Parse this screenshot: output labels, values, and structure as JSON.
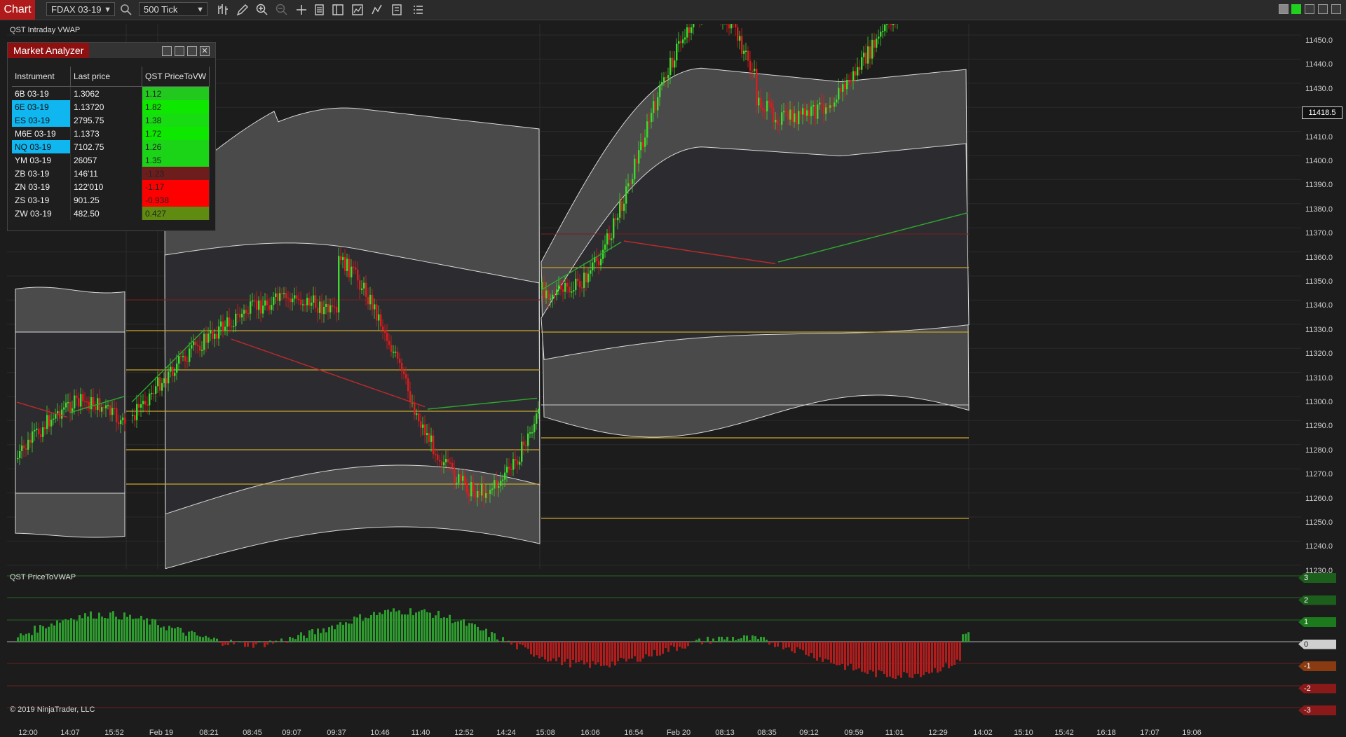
{
  "toolbar": {
    "chart_tab": "Chart",
    "instrument": "FDAX 03-19",
    "interval": "500 Tick"
  },
  "plot": {
    "title": "QST Intraday VWAP",
    "last_price": "11418.5",
    "price_ticks": [
      "11450.0",
      "11440.0",
      "11430.0",
      "11420.0",
      "11410.0",
      "11400.0",
      "11390.0",
      "11380.0",
      "11370.0",
      "11360.0",
      "11350.0",
      "11340.0",
      "11330.0",
      "11320.0",
      "11310.0",
      "11300.0",
      "11290.0",
      "11280.0",
      "11270.0",
      "11260.0",
      "11250.0",
      "11240.0",
      "11230.0"
    ]
  },
  "indicator": {
    "title": "QST PriceToVWAP",
    "levels": [
      "3",
      "2",
      "1",
      "0",
      "-1",
      "-2",
      "-3"
    ]
  },
  "copyright": "© 2019 NinjaTrader, LLC",
  "time_axis": [
    "12:00",
    "14:07",
    "15:52",
    "Feb 19",
    "08:21",
    "08:45",
    "09:07",
    "09:37",
    "10:46",
    "11:40",
    "12:52",
    "14:24",
    "15:08",
    "16:06",
    "16:54",
    "Feb 20",
    "08:13",
    "08:35",
    "09:12",
    "09:59",
    "11:01",
    "12:29",
    "14:02",
    "15:10",
    "15:42",
    "16:18",
    "17:07",
    "19:06"
  ],
  "market_analyzer": {
    "title": "Market Analyzer",
    "columns": [
      "Instrument",
      "Last price",
      "QST PriceToVW"
    ],
    "rows": [
      {
        "instrument": "6B 03-19",
        "last": "1.3062",
        "value": "1.12",
        "color": "#22c81e",
        "hl": false
      },
      {
        "instrument": "6E 03-19",
        "last": "1.13720",
        "value": "1.82",
        "color": "#0ee800",
        "hl": true
      },
      {
        "instrument": "ES 03-19",
        "last": "2795.75",
        "value": "1.38",
        "color": "#17dc12",
        "hl": true
      },
      {
        "instrument": "M6E 03-19",
        "last": "1.1373",
        "value": "1.72",
        "color": "#0ee800",
        "hl": false
      },
      {
        "instrument": "NQ 03-19",
        "last": "7102.75",
        "value": "1.26",
        "color": "#1bd418",
        "hl": true
      },
      {
        "instrument": "YM 03-19",
        "last": "26057",
        "value": "1.35",
        "color": "#1bd418",
        "hl": false
      },
      {
        "instrument": "ZB 03-19",
        "last": "146'11",
        "value": "-1.23",
        "color": "#6e1d1d",
        "hl": false
      },
      {
        "instrument": "ZN 03-19",
        "last": "122'010",
        "value": "-1.17",
        "color": "#ff0000",
        "hl": false
      },
      {
        "instrument": "ZS 03-19",
        "last": "901.25",
        "value": "-0.938",
        "color": "#ff0000",
        "hl": false
      },
      {
        "instrument": "ZW 03-19",
        "last": "482.50",
        "value": "0.427",
        "color": "#5f8c10",
        "hl": false
      }
    ]
  },
  "colors": {
    "up": "#3ddc2c",
    "down": "#e01b1b",
    "band": "#4a4a4a",
    "vwap_up": "#2fa82f",
    "vwap_dn": "#c02a2a",
    "level": "#c8a530"
  }
}
